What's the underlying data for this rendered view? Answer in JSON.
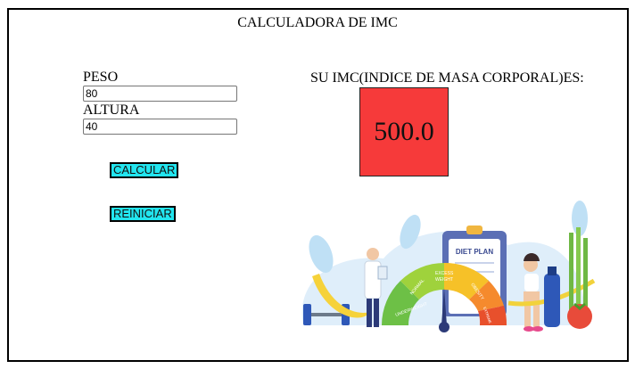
{
  "header": {
    "title": "CALCULADORA DE IMC"
  },
  "form": {
    "weight_label": "PESO",
    "weight_value": "80",
    "height_label": "ALTURA",
    "height_value": "40",
    "calculate_label": "CALCULAR",
    "reset_label": "REINICIAR"
  },
  "result": {
    "label": "SU IMC(INDICE DE MASA CORPORAL)ES:",
    "value": "500.0",
    "color": "#f63a3a"
  },
  "illustration": {
    "plan_title": "DIET PLAN",
    "gauge_segments": [
      "UNDERWEIGHT",
      "NORMAL",
      "EXCESS WEIGHT",
      "OBESITY",
      "EXTREME OBESITY"
    ]
  },
  "colors": {
    "button_bg": "#22e5ef"
  }
}
